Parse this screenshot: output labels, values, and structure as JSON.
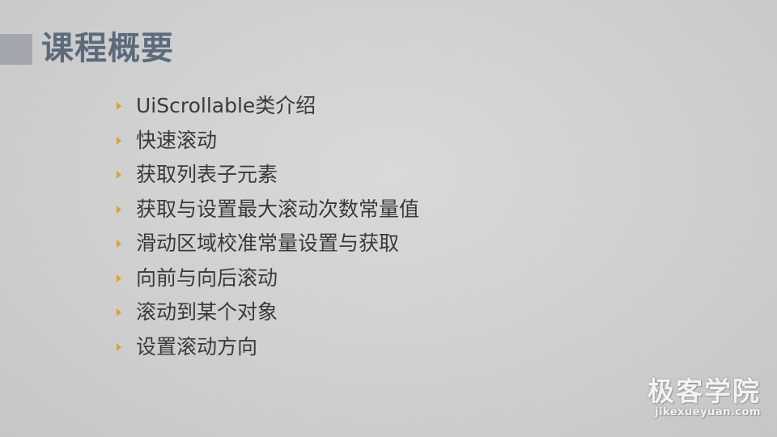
{
  "slide": {
    "title": "课程概要",
    "bullets": [
      "UiScrollable类介绍",
      "快速滚动",
      "获取列表子元素",
      "获取与设置最大滚动次数常量值",
      "滑动区域校准常量设置与获取",
      "向前与向后滚动",
      "滚动到某个对象",
      "设置滚动方向"
    ]
  },
  "watermark": {
    "brand": "极客学院",
    "url": "jikexueyuan.com"
  },
  "colors": {
    "background": "#d2d2d2",
    "title": "#5c6b7b",
    "title_square": "#a2a6ae",
    "bullet_marker": "#e0a12b",
    "body_text": "#3a3a3a"
  },
  "icons": {
    "bullet": "triangle-right-icon"
  }
}
